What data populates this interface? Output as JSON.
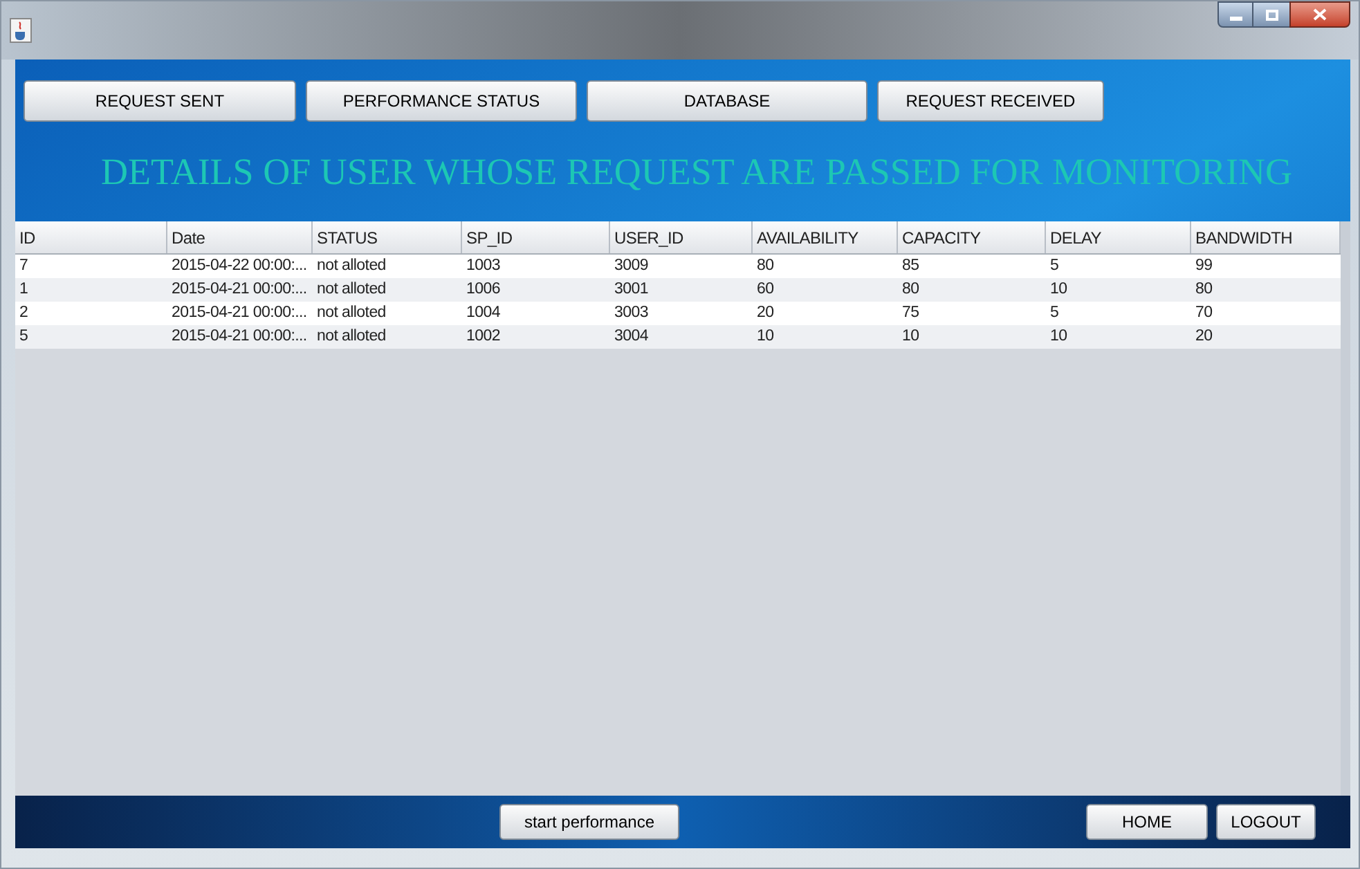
{
  "nav_buttons": [
    "REQUEST SENT",
    "PERFORMANCE STATUS",
    "DATABASE",
    "REQUEST RECEIVED"
  ],
  "heading": "DETAILS OF USER WHOSE REQUEST ARE PASSED FOR MONITORING",
  "table": {
    "columns": [
      "ID",
      "Date",
      "STATUS",
      "SP_ID",
      "USER_ID",
      "AVAILABILITY",
      "CAPACITY",
      "DELAY",
      "BANDWIDTH"
    ],
    "rows": [
      [
        "7",
        "2015-04-22 00:00:...",
        "not alloted",
        "1003",
        "3009",
        "80",
        "85",
        "5",
        "99"
      ],
      [
        "1",
        "2015-04-21 00:00:...",
        "not alloted",
        "1006",
        "3001",
        "60",
        "80",
        "10",
        "80"
      ],
      [
        "2",
        "2015-04-21 00:00:...",
        "not alloted",
        "1004",
        "3003",
        "20",
        "75",
        "5",
        "70"
      ],
      [
        "5",
        "2015-04-21 00:00:...",
        "not alloted",
        "1002",
        "3004",
        "10",
        "10",
        "10",
        "20"
      ]
    ]
  },
  "bottom_buttons": {
    "start": "start performance",
    "home": "HOME",
    "logout": "LOGOUT"
  }
}
